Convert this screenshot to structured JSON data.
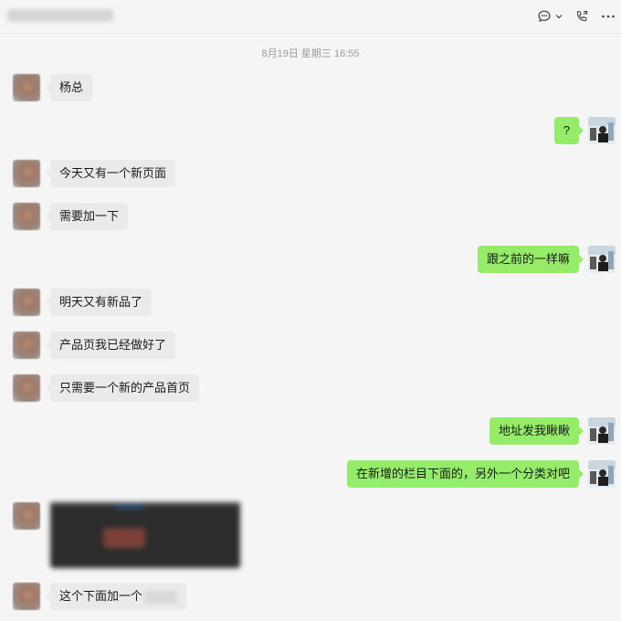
{
  "header": {
    "title": "",
    "icons": [
      "chat-options-icon",
      "chevron-down-icon",
      "voice-call-icon",
      "more-icon"
    ]
  },
  "timestamp": "8月19日 星期三 16:55",
  "colors": {
    "self_bubble": "#95ec69",
    "other_bubble": "#eaeaea",
    "background": "#f5f5f5"
  },
  "messages": [
    {
      "side": "left",
      "text": "杨总"
    },
    {
      "side": "right",
      "text": "?"
    },
    {
      "side": "left",
      "text": "今天又有一个新页面"
    },
    {
      "side": "left",
      "text": "需要加一下"
    },
    {
      "side": "right",
      "text": "跟之前的一样嘛"
    },
    {
      "side": "left",
      "text": "明天又有新品了"
    },
    {
      "side": "left",
      "text": "产品页我已经做好了"
    },
    {
      "side": "left",
      "text": "只需要一个新的产品首页"
    },
    {
      "side": "right",
      "text": "地址发我瞅瞅"
    },
    {
      "side": "right",
      "text": "在新增的栏目下面的，另外一个分类对吧"
    },
    {
      "side": "left",
      "text": "",
      "type": "image"
    },
    {
      "side": "left",
      "text": "这个下面加一个"
    }
  ]
}
